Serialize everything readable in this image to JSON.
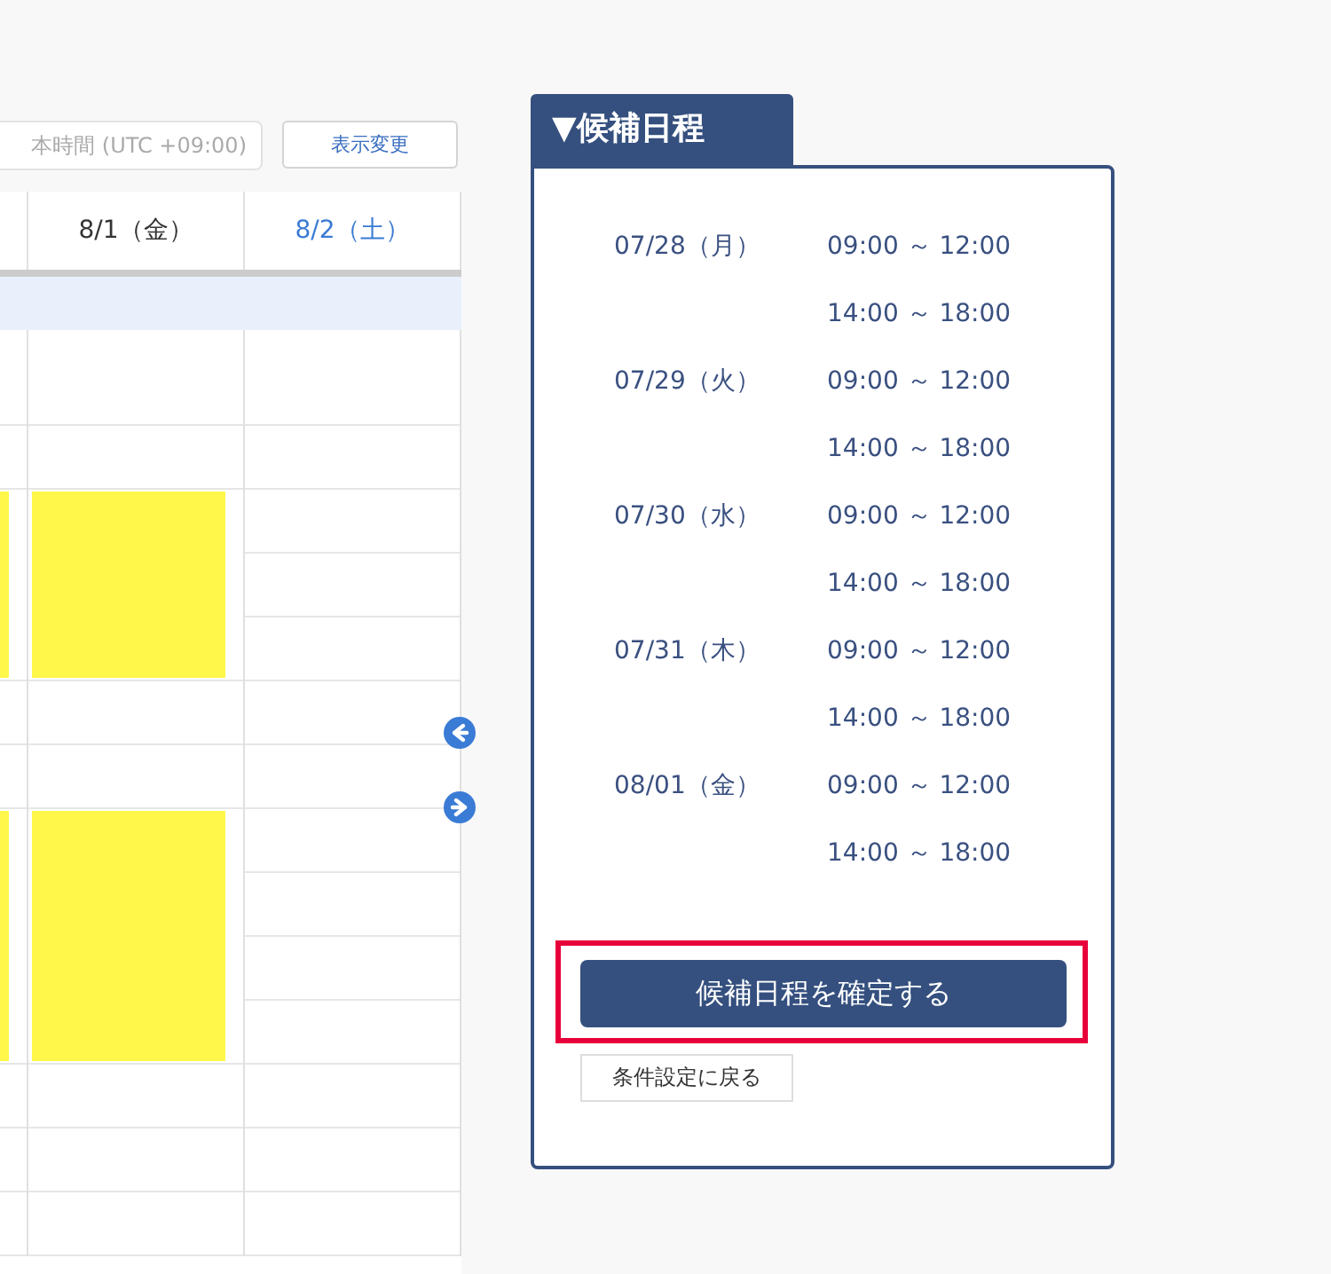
{
  "toolbar": {
    "timezone": "本時間 (UTC +09:00)",
    "change_button": "表示変更"
  },
  "calendar": {
    "columns": [
      {
        "label": "8/1（金）",
        "kind": "weekday"
      },
      {
        "label": "8/2（土）",
        "kind": "saturday"
      }
    ],
    "slots": [
      {
        "available": [
          false,
          false,
          false
        ]
      },
      {
        "available": [
          false,
          false,
          false
        ]
      },
      {
        "available": [
          true,
          true,
          false
        ]
      },
      {
        "available": [
          true,
          true,
          false
        ]
      },
      {
        "available": [
          true,
          true,
          false
        ]
      },
      {
        "available": [
          false,
          false,
          false
        ]
      },
      {
        "available": [
          false,
          false,
          false
        ]
      },
      {
        "available": [
          true,
          true,
          false
        ]
      },
      {
        "available": [
          true,
          true,
          false
        ]
      },
      {
        "available": [
          true,
          true,
          false
        ]
      },
      {
        "available": [
          true,
          true,
          false
        ]
      },
      {
        "available": [
          false,
          false,
          false
        ]
      },
      {
        "available": [
          false,
          false,
          false
        ]
      },
      {
        "available": [
          false,
          false,
          false
        ]
      }
    ]
  },
  "panel": {
    "title": "▼候補日程",
    "entries": [
      {
        "date": "07/28（月）",
        "times": [
          "09:00 ～ 12:00",
          "14:00 ～ 18:00"
        ]
      },
      {
        "date": "07/29（火）",
        "times": [
          "09:00 ～ 12:00",
          "14:00 ～ 18:00"
        ]
      },
      {
        "date": "07/30（水）",
        "times": [
          "09:00 ～ 12:00",
          "14:00 ～ 18:00"
        ]
      },
      {
        "date": "07/31（木）",
        "times": [
          "09:00 ～ 12:00",
          "14:00 ～ 18:00"
        ]
      },
      {
        "date": "08/01（金）",
        "times": [
          "09:00 ～ 12:00",
          "14:00 ～ 18:00"
        ]
      }
    ],
    "confirm_button": {
      "label": "候補日程を確定する",
      "highlighted": true
    },
    "back_button": "条件設定に戻る"
  }
}
